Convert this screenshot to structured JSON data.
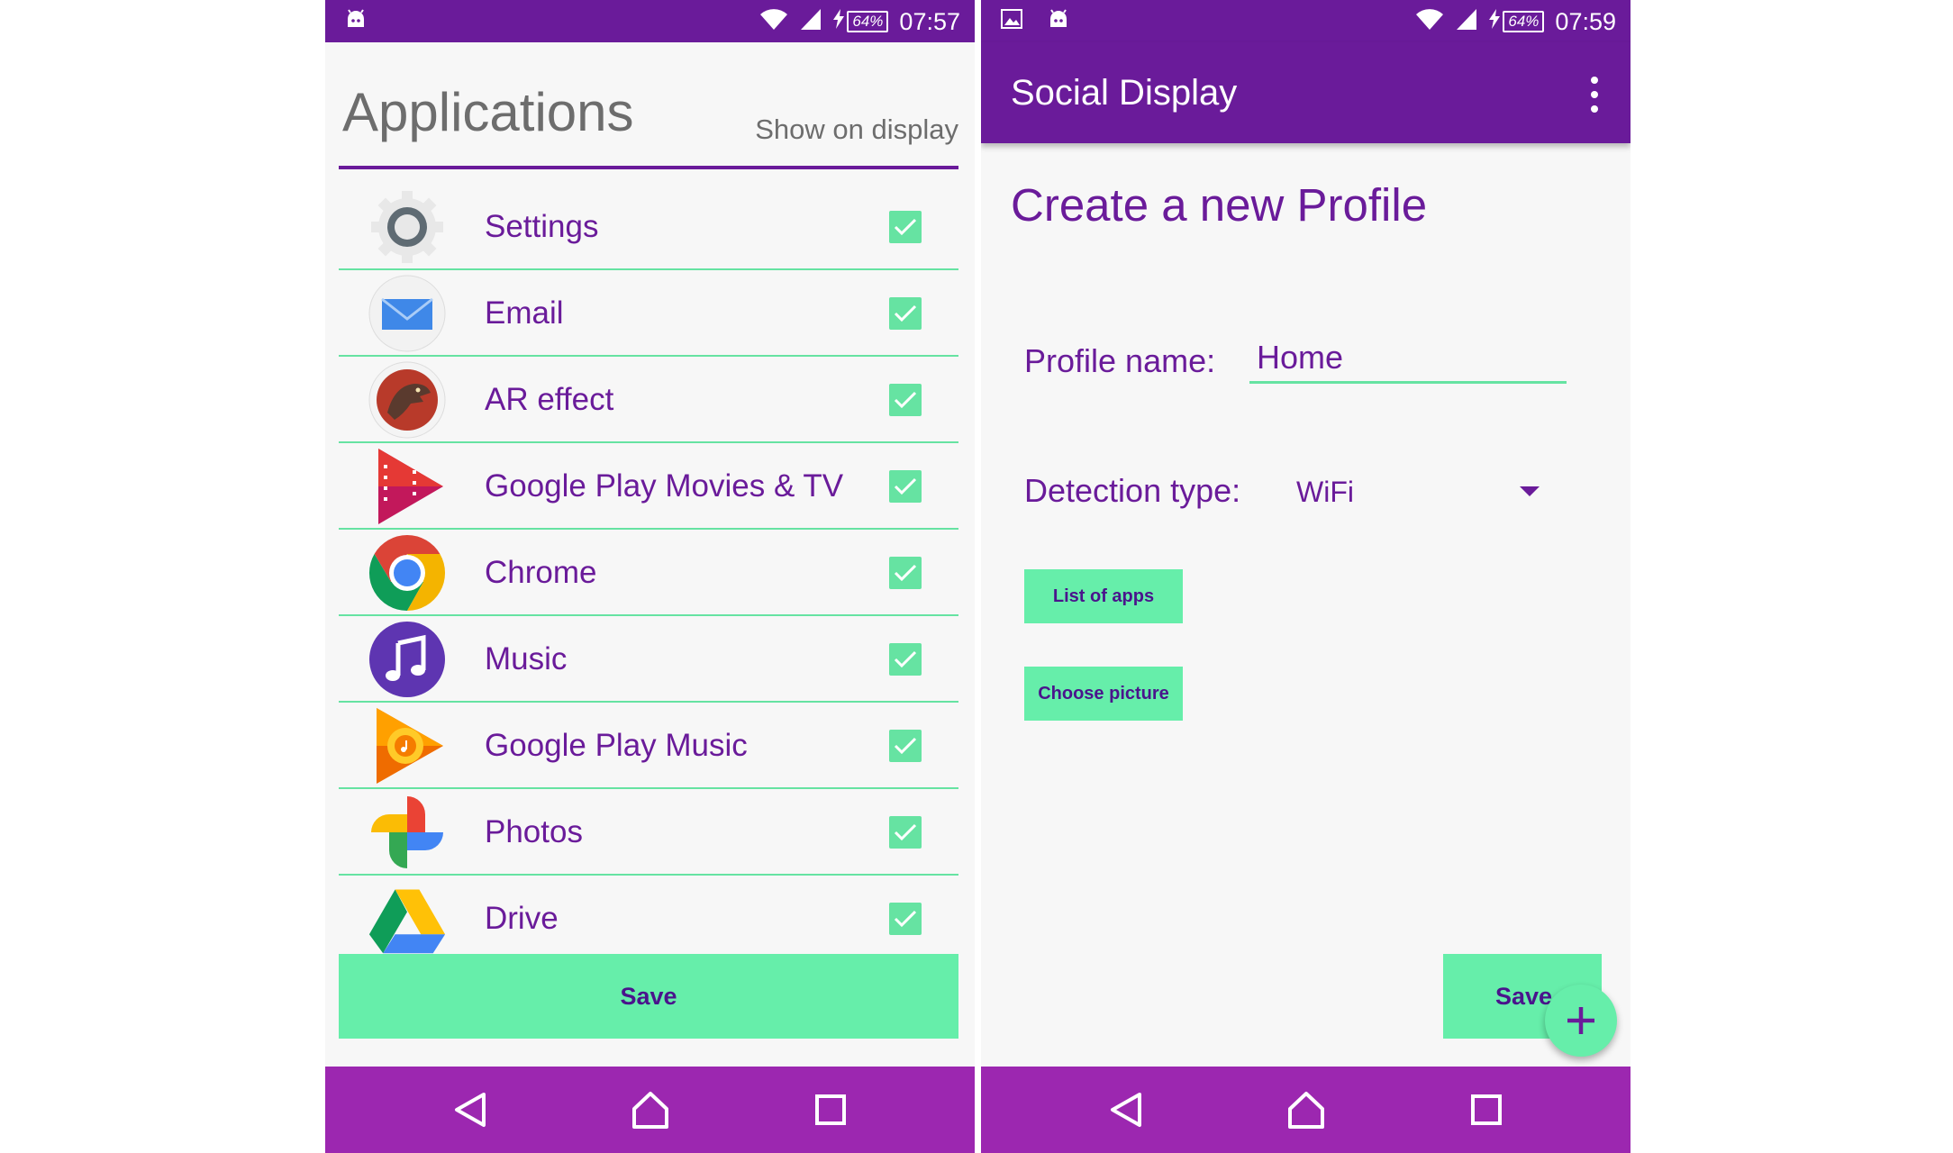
{
  "left_screen": {
    "status": {
      "battery": "64%",
      "time": "07:57"
    },
    "title": "Applications",
    "subtitle": "Show on display",
    "apps": [
      {
        "name": "Settings",
        "icon": "settings-icon",
        "checked": true
      },
      {
        "name": "Email",
        "icon": "email-icon",
        "checked": true
      },
      {
        "name": "AR effect",
        "icon": "ar-effect-icon",
        "checked": true
      },
      {
        "name": "Google Play Movies & TV",
        "icon": "play-movies-icon",
        "checked": true
      },
      {
        "name": "Chrome",
        "icon": "chrome-icon",
        "checked": true
      },
      {
        "name": "Music",
        "icon": "music-icon",
        "checked": true
      },
      {
        "name": "Google Play Music",
        "icon": "play-music-icon",
        "checked": true
      },
      {
        "name": "Photos",
        "icon": "photos-icon",
        "checked": true
      },
      {
        "name": "Drive",
        "icon": "drive-icon",
        "checked": true
      }
    ],
    "save_label": "Save"
  },
  "right_screen": {
    "status": {
      "battery": "64%",
      "time": "07:59"
    },
    "app_title": "Social Display",
    "page_title": "Create a new Profile",
    "profile_name_label": "Profile name:",
    "profile_name_value": "Home",
    "detection_type_label": "Detection type:",
    "detection_type_value": "WiFi",
    "list_apps_label": "List of apps",
    "choose_picture_label": "Choose picture",
    "save_label": "Save"
  },
  "colors": {
    "primary": "#6a1b9a",
    "nav_bar": "#9c27b0",
    "accent": "#66eeaa",
    "text_gray": "#6d6d6d"
  }
}
